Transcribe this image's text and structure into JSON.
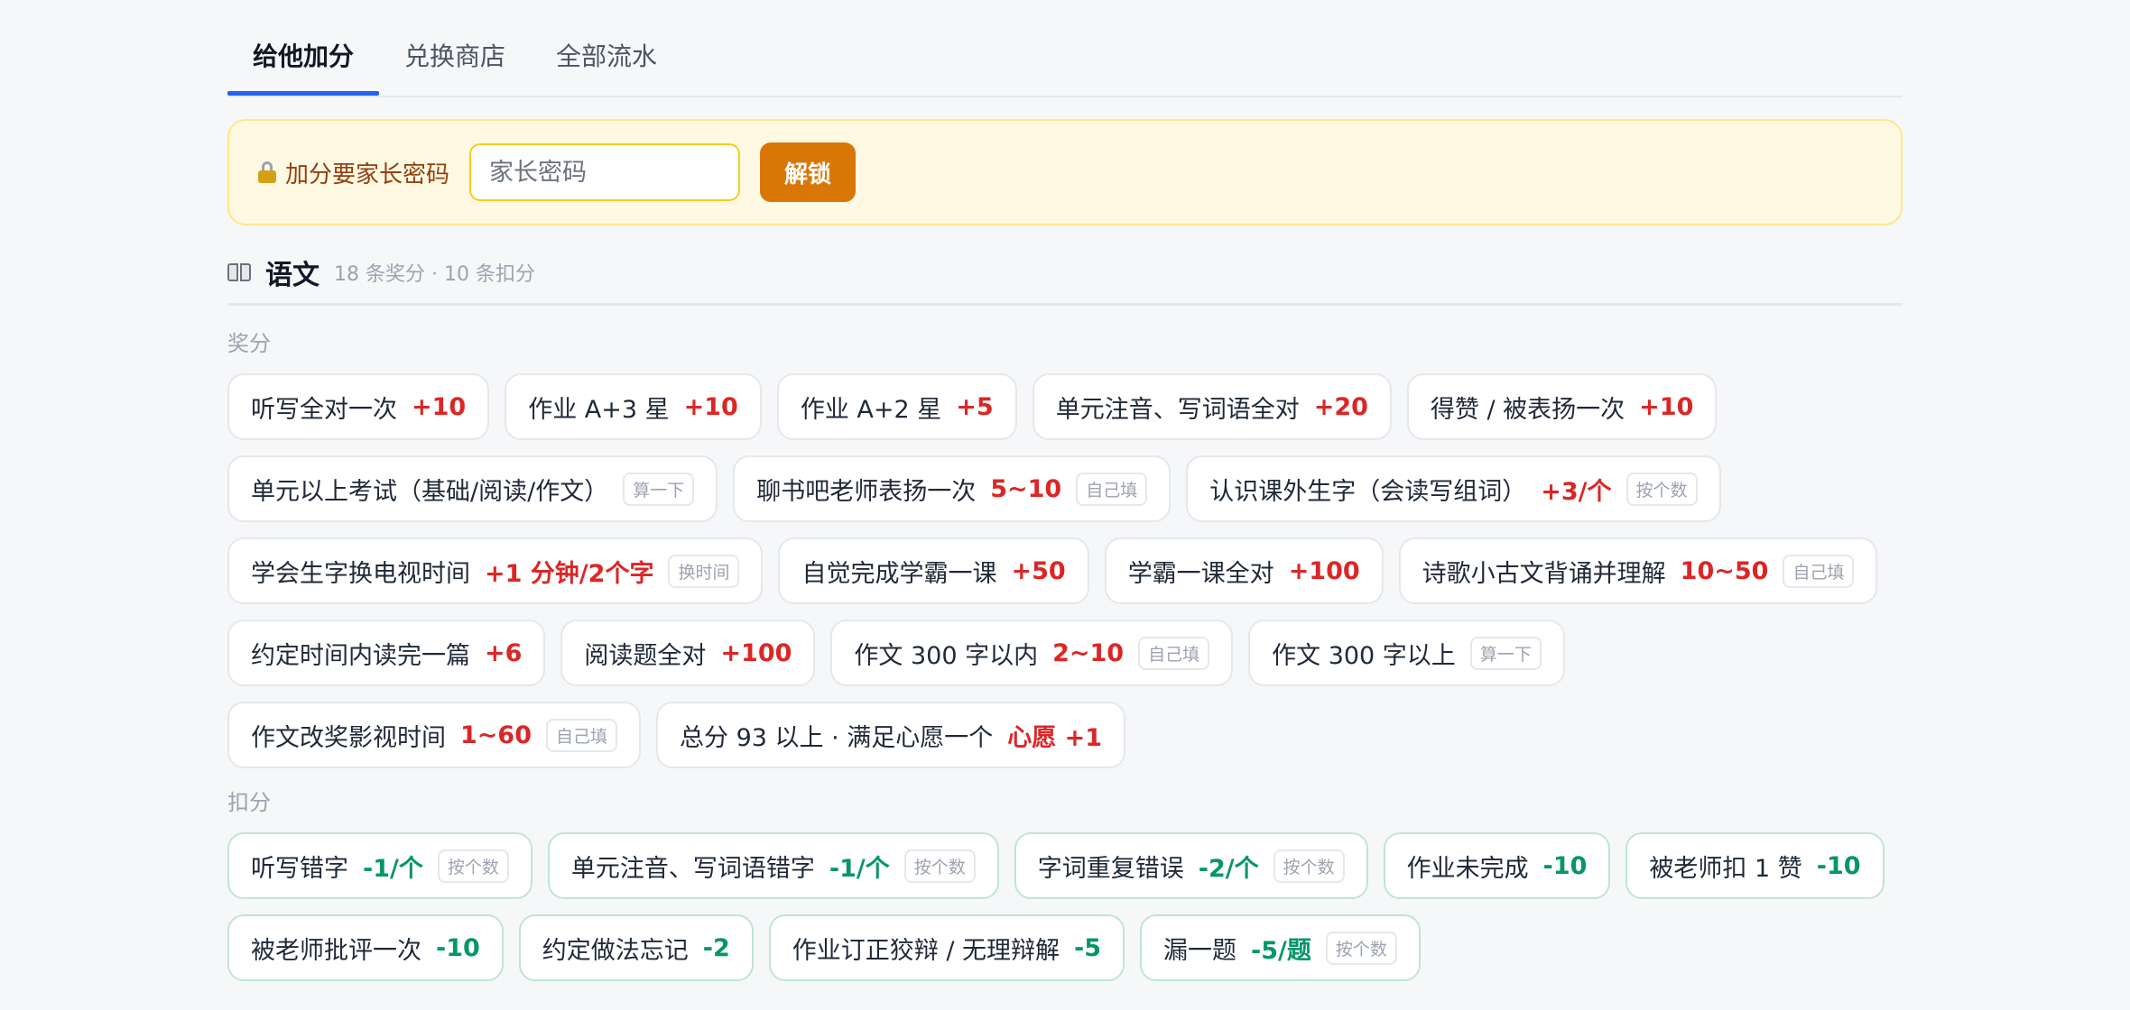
{
  "tabs": [
    {
      "label": "给他加分",
      "active": true
    },
    {
      "label": "兑换商店",
      "active": false
    },
    {
      "label": "全部流水",
      "active": false
    }
  ],
  "lock": {
    "icon": "lock-icon",
    "label": "加分要家长密码",
    "placeholder": "家长密码",
    "button": "解锁"
  },
  "subject": {
    "icon": "book-icon",
    "name": "语文",
    "meta": "18 条奖分 · 10 条扣分"
  },
  "award_title": "奖分",
  "awards": [
    {
      "name": "听写全对一次",
      "points": "+10"
    },
    {
      "name": "作业 A+3 星",
      "points": "+10"
    },
    {
      "name": "作业 A+2 星",
      "points": "+5"
    },
    {
      "name": "单元注音、写词语全对",
      "points": "+20"
    },
    {
      "name": "得赞 / 被表扬一次",
      "points": "+10"
    },
    {
      "name": "单元以上考试（基础/阅读/作文）",
      "points": "",
      "tag": "算一下"
    },
    {
      "name": "聊书吧老师表扬一次",
      "points": "5~10",
      "tag": "自己填"
    },
    {
      "name": "认识课外生字（会读写组词）",
      "points": "+3/个",
      "tag": "按个数"
    },
    {
      "name": "学会生字换电视时间",
      "points": "+1 分钟/2个字",
      "tag": "换时间"
    },
    {
      "name": "自觉完成学霸一课",
      "points": "+50"
    },
    {
      "name": "学霸一课全对",
      "points": "+100"
    },
    {
      "name": "诗歌小古文背诵并理解",
      "points": "10~50",
      "tag": "自己填"
    },
    {
      "name": "约定时间内读完一篇",
      "points": "+6"
    },
    {
      "name": "阅读题全对",
      "points": "+100"
    },
    {
      "name": "作文 300 字以内",
      "points": "2~10",
      "tag": "自己填"
    },
    {
      "name": "作文 300 字以上",
      "points": "",
      "tag": "算一下"
    },
    {
      "name": "作文改奖影视时间",
      "points": "1~60",
      "tag": "自己填"
    },
    {
      "name": "总分 93 以上 · 满足心愿一个",
      "points": "心愿 +1"
    }
  ],
  "deduct_title": "扣分",
  "deductions": [
    {
      "name": "听写错字",
      "points": "-1/个",
      "tag": "按个数"
    },
    {
      "name": "单元注音、写词语错字",
      "points": "-1/个",
      "tag": "按个数"
    },
    {
      "name": "字词重复错误",
      "points": "-2/个",
      "tag": "按个数"
    },
    {
      "name": "作业未完成",
      "points": "-10"
    },
    {
      "name": "被老师扣 1 赞",
      "points": "-10"
    },
    {
      "name": "被老师批评一次",
      "points": "-10"
    },
    {
      "name": "约定做法忘记",
      "points": "-2"
    },
    {
      "name": "作业订正狡辩 / 无理辩解",
      "points": "-5"
    },
    {
      "name": "漏一题",
      "points": "-5/题",
      "tag": "按个数"
    }
  ]
}
